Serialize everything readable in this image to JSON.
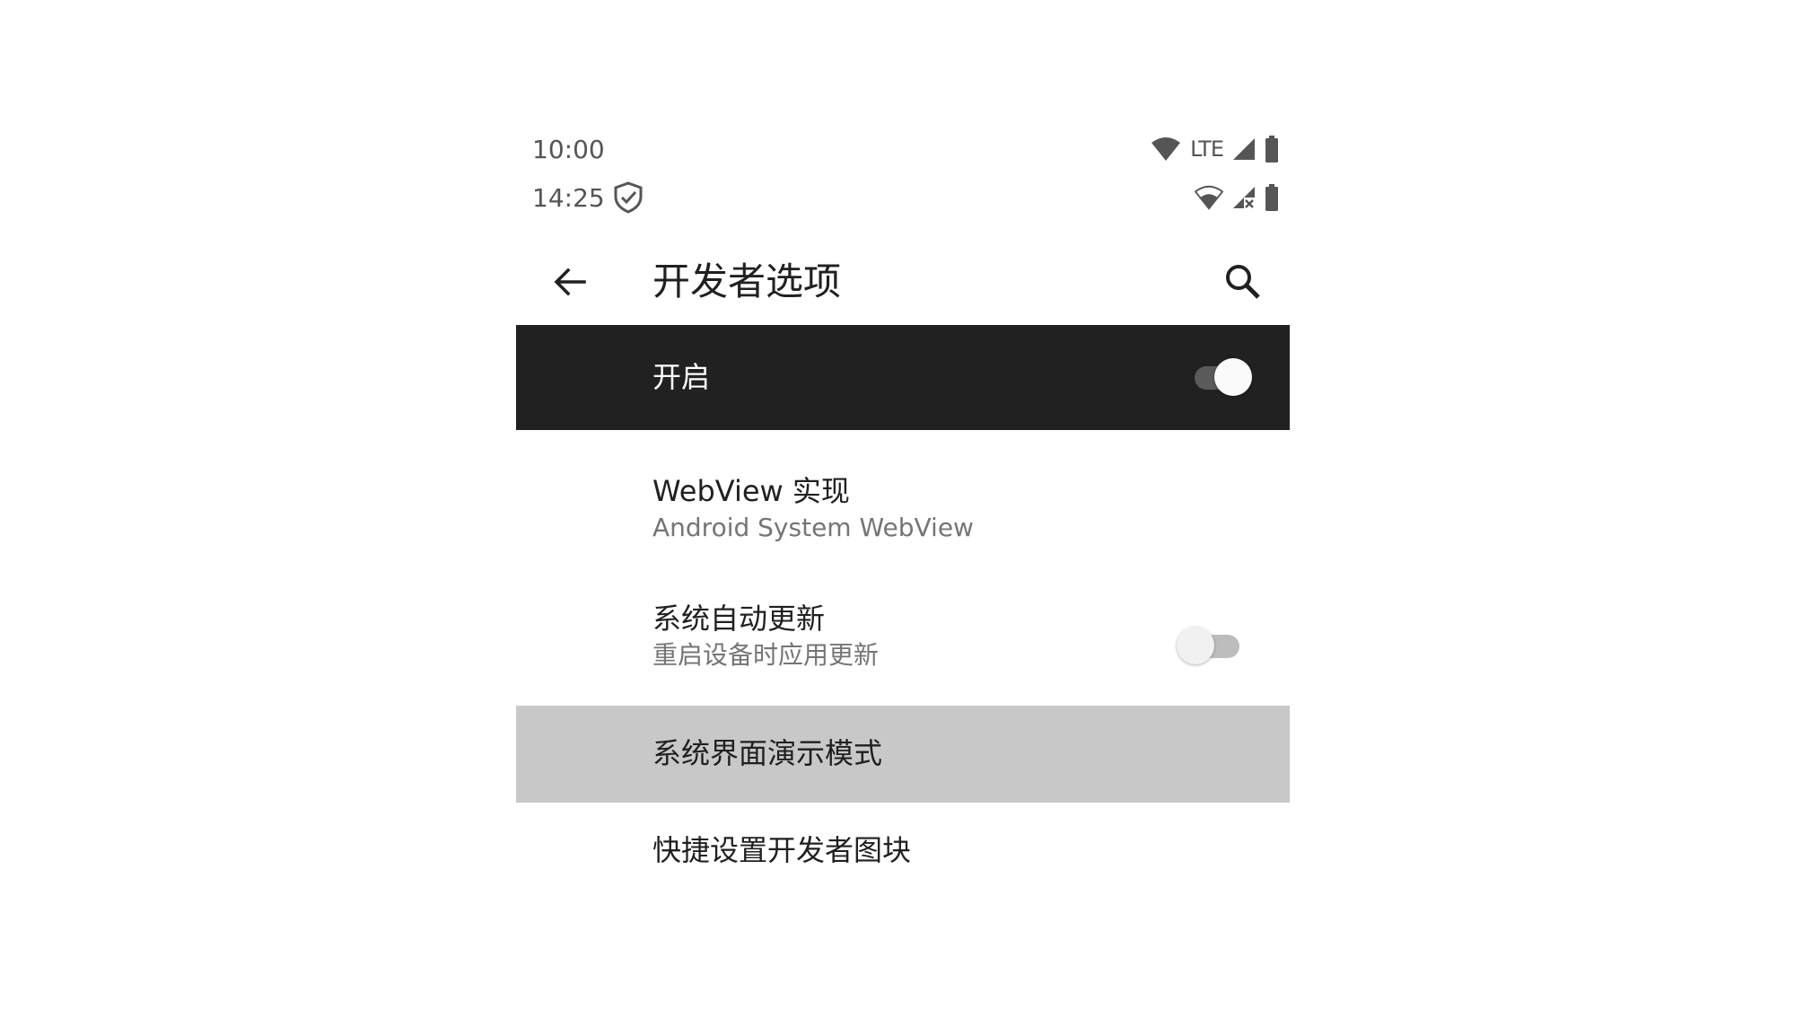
{
  "status_bar_1": {
    "time": "10:00",
    "network_label": "LTE",
    "icons": [
      "wifi-icon",
      "lte-signal-icon",
      "battery-icon"
    ]
  },
  "status_bar_2": {
    "time": "14:25",
    "icons": [
      "shield-check-icon",
      "wifi-icon",
      "no-signal-icon",
      "battery-icon"
    ]
  },
  "toolbar": {
    "title": "开发者选项",
    "back_icon": "arrow-back-icon",
    "search_icon": "search-icon"
  },
  "master_switch": {
    "label": "开启",
    "enabled": true
  },
  "preferences": {
    "webview": {
      "title": "WebView 实现",
      "summary": "Android System WebView"
    },
    "auto_update": {
      "title": "系统自动更新",
      "summary": "重启设备时应用更新",
      "enabled": false
    },
    "demo_mode": {
      "title": "系统界面演示模式",
      "highlighted": true
    },
    "quick_tiles": {
      "title": "快捷设置开发者图块"
    }
  },
  "colors": {
    "master_bg": "#212121",
    "highlight_bg": "#c8c8c8",
    "secondary_text": "#757575"
  }
}
